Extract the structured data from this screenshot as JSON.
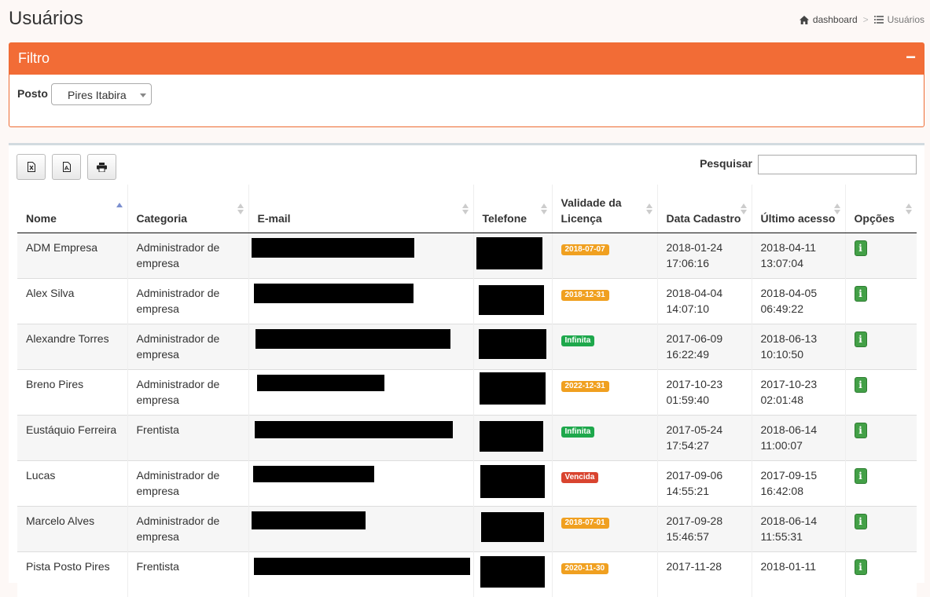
{
  "page": {
    "title": "Usuários"
  },
  "breadcrumb": {
    "home": "dashboard",
    "separator": ">",
    "current": "Usuários"
  },
  "filter": {
    "title": "Filtro",
    "collapse": "−",
    "posto_label": "Posto",
    "posto_value": "Pires Itabira"
  },
  "toolbar": {
    "icons": [
      "excel-icon",
      "pdf-icon",
      "print-icon"
    ],
    "search_label": "Pesquisar",
    "search_value": ""
  },
  "table": {
    "headers": [
      "Nome",
      "Categoria",
      "E-mail",
      "Telefone",
      "Validade da Licença",
      "Data Cadastro",
      "Último acesso",
      "Opções"
    ],
    "rows": [
      {
        "nome": "ADM Empresa",
        "categoria": "Administrador de empresa",
        "licenca": "2018-07-07",
        "licenca_color": "#f0a020",
        "cadastro": "2018-01-24 17:06:16",
        "acesso": "2018-04-11 13:07:04"
      },
      {
        "nome": "Alex Silva",
        "categoria": "Administrador de empresa",
        "licenca": "2018-12-31",
        "licenca_color": "#f0a020",
        "cadastro": "2018-04-04 14:07:10",
        "acesso": "2018-04-05 06:49:22"
      },
      {
        "nome": "Alexandre Torres",
        "categoria": "Administrador de empresa",
        "licenca": "Infinita",
        "licenca_color": "#1ea84c",
        "cadastro": "2017-06-09 16:22:49",
        "acesso": "2018-06-13 10:10:50"
      },
      {
        "nome": "Breno Pires",
        "categoria": "Administrador de empresa",
        "licenca": "2022-12-31",
        "licenca_color": "#f0a020",
        "cadastro": "2017-10-23 01:59:40",
        "acesso": "2017-10-23 02:01:48"
      },
      {
        "nome": "Eustáquio Ferreira",
        "categoria": "Frentista",
        "licenca": "Infinita",
        "licenca_color": "#1ea84c",
        "cadastro": "2017-05-24 17:54:27",
        "acesso": "2018-06-14 11:00:07"
      },
      {
        "nome": "Lucas",
        "categoria": "Administrador de empresa",
        "licenca": "Vencida",
        "licenca_color": "#d9442f",
        "cadastro": "2017-09-06 14:55:21",
        "acesso": "2017-09-15 16:42:08"
      },
      {
        "nome": "Marcelo Alves",
        "categoria": "Administrador de empresa",
        "licenca": "2018-07-01",
        "licenca_color": "#f0a020",
        "cadastro": "2017-09-28 15:46:57",
        "acesso": "2018-06-14 11:55:31"
      },
      {
        "nome": "Pista Posto Pires",
        "categoria": "Frentista",
        "licenca": "2020-11-30",
        "licenca_color": "#f0a020",
        "cadastro": "2017-11-28",
        "acesso": "2018-01-11"
      }
    ],
    "info_glyph": "i"
  }
}
